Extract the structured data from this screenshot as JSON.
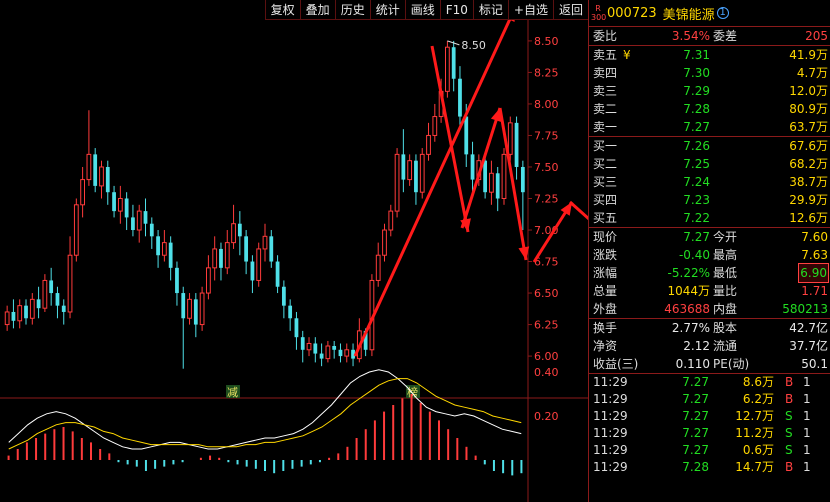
{
  "toolbar": {
    "buttons": [
      "复权",
      "叠加",
      "历史",
      "统计",
      "画线",
      "F10",
      "标记",
      "+自选",
      "返回"
    ]
  },
  "stock": {
    "code": "000723",
    "name": "美锦能源",
    "market_mark_top": "R",
    "market_mark_bottom": "300"
  },
  "committee": {
    "ratio_label": "委比",
    "ratio_value": "3.54%",
    "diff_label": "委差",
    "diff_value": "205"
  },
  "sell": [
    {
      "label": "卖五",
      "price": "7.31",
      "volume": "41.9万"
    },
    {
      "label": "卖四",
      "price": "7.30",
      "volume": "4.7万"
    },
    {
      "label": "卖三",
      "price": "7.29",
      "volume": "12.0万"
    },
    {
      "label": "卖二",
      "price": "7.28",
      "volume": "80.9万"
    },
    {
      "label": "卖一",
      "price": "7.27",
      "volume": "63.7万"
    }
  ],
  "sell_currency_mark": "¥",
  "buy": [
    {
      "label": "买一",
      "price": "7.26",
      "volume": "67.6万"
    },
    {
      "label": "买二",
      "price": "7.25",
      "volume": "68.2万"
    },
    {
      "label": "买三",
      "price": "7.24",
      "volume": "38.7万"
    },
    {
      "label": "买四",
      "price": "7.23",
      "volume": "29.9万"
    },
    {
      "label": "买五",
      "price": "7.22",
      "volume": "12.6万"
    }
  ],
  "quote": [
    {
      "l1": "现价",
      "v1": "7.27",
      "c1": "grn",
      "l2": "今开",
      "v2": "7.60",
      "c2": "yel"
    },
    {
      "l1": "涨跌",
      "v1": "-0.40",
      "c1": "grn",
      "l2": "最高",
      "v2": "7.63",
      "c2": "yel"
    },
    {
      "l1": "涨幅",
      "v1": "-5.22%",
      "c1": "grn",
      "l2": "最低",
      "v2": "6.90",
      "c2": "grn box"
    },
    {
      "l1": "总量",
      "v1": "1044万",
      "c1": "yel",
      "l2": "量比",
      "v2": "1.71",
      "c2": "red"
    },
    {
      "l1": "外盘",
      "v1": "463688",
      "c1": "red",
      "l2": "内盘",
      "v2": "580213",
      "c2": "grn"
    }
  ],
  "fund": [
    {
      "l1": "换手",
      "v1": "2.77%",
      "l2": "股本",
      "v2": "42.7亿"
    },
    {
      "l1": "净资",
      "v1": "2.12",
      "l2": "流通",
      "v2": "37.7亿"
    },
    {
      "l1": "收益(三)",
      "v1": "0.110",
      "l2": "PE(动)",
      "v2": "50.1"
    }
  ],
  "ticks": [
    {
      "time": "11:29",
      "price": "7.27",
      "vol": "8.6万",
      "side": "B",
      "n": "1"
    },
    {
      "time": "11:29",
      "price": "7.27",
      "vol": "6.2万",
      "side": "B",
      "n": "1"
    },
    {
      "time": "11:29",
      "price": "7.27",
      "vol": "12.7万",
      "side": "S",
      "n": "1"
    },
    {
      "time": "11:29",
      "price": "7.27",
      "vol": "11.2万",
      "side": "S",
      "n": "1"
    },
    {
      "time": "11:29",
      "price": "7.27",
      "vol": "0.6万",
      "side": "S",
      "n": "1"
    },
    {
      "time": "11:29",
      "price": "7.28",
      "vol": "14.7万",
      "side": "B",
      "n": "1"
    }
  ],
  "chart_data": {
    "type": "candlestick",
    "yticks": [
      "8.50",
      "8.25",
      "8.00",
      "7.75",
      "7.50",
      "7.25",
      "7.00",
      "6.75",
      "6.50",
      "6.25",
      "6.00"
    ],
    "ylim": [
      5.85,
      8.65
    ],
    "high_label": "8.50",
    "event_labels": [
      "减",
      "榜"
    ],
    "macd_ticks": [
      "0.40",
      "0.20"
    ],
    "candles": [
      [
        6.25,
        6.35,
        6.2,
        6.4
      ],
      [
        6.35,
        6.28,
        6.22,
        6.45
      ],
      [
        6.28,
        6.4,
        6.22,
        6.45
      ],
      [
        6.4,
        6.3,
        6.25,
        6.45
      ],
      [
        6.3,
        6.45,
        6.25,
        6.5
      ],
      [
        6.45,
        6.38,
        6.3,
        6.55
      ],
      [
        6.38,
        6.6,
        6.35,
        6.65
      ],
      [
        6.6,
        6.5,
        6.4,
        6.7
      ],
      [
        6.5,
        6.4,
        6.3,
        6.55
      ],
      [
        6.4,
        6.35,
        6.25,
        6.45
      ],
      [
        6.35,
        6.8,
        6.3,
        6.95
      ],
      [
        6.8,
        7.2,
        6.75,
        7.25
      ],
      [
        7.2,
        7.4,
        7.1,
        7.5
      ],
      [
        7.4,
        7.6,
        7.35,
        7.95
      ],
      [
        7.6,
        7.35,
        7.3,
        7.65
      ],
      [
        7.35,
        7.5,
        7.25,
        7.55
      ],
      [
        7.5,
        7.3,
        7.2,
        7.55
      ],
      [
        7.3,
        7.15,
        7.1,
        7.35
      ],
      [
        7.15,
        7.25,
        7.05,
        7.35
      ],
      [
        7.25,
        7.1,
        7.0,
        7.3
      ],
      [
        7.1,
        7.0,
        6.95,
        7.2
      ],
      [
        7.0,
        7.15,
        6.9,
        7.2
      ],
      [
        7.15,
        7.05,
        6.95,
        7.25
      ],
      [
        7.05,
        6.95,
        6.85,
        7.1
      ],
      [
        6.95,
        6.8,
        6.7,
        7.0
      ],
      [
        6.8,
        6.9,
        6.75,
        7.0
      ],
      [
        6.9,
        6.7,
        6.6,
        6.95
      ],
      [
        6.7,
        6.5,
        6.4,
        6.75
      ],
      [
        6.5,
        6.3,
        5.9,
        6.55
      ],
      [
        6.3,
        6.45,
        6.25,
        6.5
      ],
      [
        6.45,
        6.25,
        6.15,
        6.5
      ],
      [
        6.25,
        6.5,
        6.2,
        6.55
      ],
      [
        6.5,
        6.7,
        6.45,
        6.8
      ],
      [
        6.7,
        6.85,
        6.6,
        6.95
      ],
      [
        6.85,
        6.7,
        6.6,
        6.9
      ],
      [
        6.7,
        6.9,
        6.65,
        7.0
      ],
      [
        6.9,
        7.05,
        6.85,
        7.2
      ],
      [
        7.05,
        6.95,
        6.8,
        7.15
      ],
      [
        6.95,
        6.75,
        6.65,
        7.0
      ],
      [
        6.75,
        6.6,
        6.5,
        6.8
      ],
      [
        6.6,
        6.85,
        6.55,
        6.9
      ],
      [
        6.85,
        6.95,
        6.75,
        7.05
      ],
      [
        6.95,
        6.75,
        6.7,
        7.0
      ],
      [
        6.75,
        6.55,
        6.5,
        6.8
      ],
      [
        6.55,
        6.4,
        6.3,
        6.6
      ],
      [
        6.4,
        6.3,
        6.2,
        6.45
      ],
      [
        6.3,
        6.15,
        6.05,
        6.35
      ],
      [
        6.15,
        6.05,
        5.95,
        6.2
      ],
      [
        6.05,
        6.1,
        6.0,
        6.15
      ],
      [
        6.1,
        6.02,
        5.95,
        6.15
      ],
      [
        6.02,
        5.98,
        5.92,
        6.1
      ],
      [
        5.98,
        6.08,
        5.95,
        6.12
      ],
      [
        6.08,
        6.05,
        5.98,
        6.12
      ],
      [
        6.05,
        6.0,
        5.95,
        6.1
      ],
      [
        6.0,
        6.05,
        5.95,
        6.1
      ],
      [
        6.05,
        5.98,
        5.92,
        6.1
      ],
      [
        5.98,
        6.2,
        5.95,
        6.3
      ],
      [
        6.2,
        6.05,
        6.0,
        6.22
      ],
      [
        6.05,
        6.6,
        6.0,
        6.65
      ],
      [
        6.6,
        6.8,
        6.55,
        6.9
      ],
      [
        6.8,
        7.0,
        6.75,
        7.05
      ],
      [
        7.0,
        7.15,
        6.95,
        7.2
      ],
      [
        7.15,
        7.6,
        7.1,
        7.65
      ],
      [
        7.6,
        7.4,
        7.3,
        7.8
      ],
      [
        7.4,
        7.55,
        7.35,
        7.6
      ],
      [
        7.55,
        7.3,
        7.2,
        7.6
      ],
      [
        7.3,
        7.6,
        7.25,
        7.65
      ],
      [
        7.6,
        7.75,
        7.55,
        7.85
      ],
      [
        7.75,
        7.9,
        7.7,
        8.0
      ],
      [
        7.9,
        8.1,
        7.85,
        8.2
      ],
      [
        8.1,
        8.45,
        8.05,
        8.5
      ],
      [
        8.45,
        8.2,
        8.1,
        8.5
      ],
      [
        8.2,
        7.9,
        7.8,
        8.3
      ],
      [
        7.9,
        7.6,
        7.5,
        8.0
      ],
      [
        7.6,
        7.4,
        7.3,
        7.7
      ],
      [
        7.4,
        7.55,
        7.35,
        7.6
      ],
      [
        7.55,
        7.3,
        7.25,
        7.6
      ],
      [
        7.3,
        7.45,
        7.2,
        7.55
      ],
      [
        7.45,
        7.25,
        7.15,
        7.5
      ],
      [
        7.25,
        7.6,
        7.2,
        7.65
      ],
      [
        7.6,
        7.85,
        7.55,
        7.9
      ],
      [
        7.85,
        7.5,
        7.4,
        7.9
      ],
      [
        7.5,
        7.3,
        7.0,
        7.55
      ]
    ],
    "macd": [
      0.02,
      0.05,
      0.08,
      0.1,
      0.12,
      0.14,
      0.15,
      0.13,
      0.1,
      0.08,
      0.05,
      0.03,
      -0.01,
      -0.02,
      -0.03,
      -0.05,
      -0.04,
      -0.03,
      -0.02,
      -0.01,
      0.0,
      0.01,
      0.02,
      0.01,
      -0.01,
      -0.02,
      -0.03,
      -0.04,
      -0.05,
      -0.06,
      -0.05,
      -0.04,
      -0.03,
      -0.02,
      -0.01,
      0.01,
      0.03,
      0.06,
      0.1,
      0.14,
      0.18,
      0.22,
      0.25,
      0.28,
      0.3,
      0.26,
      0.22,
      0.18,
      0.14,
      0.1,
      0.06,
      0.02,
      -0.02,
      -0.05,
      -0.06,
      -0.07,
      -0.06
    ],
    "dif": [
      0.08,
      0.12,
      0.16,
      0.19,
      0.21,
      0.22,
      0.21,
      0.19,
      0.16,
      0.13,
      0.1,
      0.08,
      0.06,
      0.05,
      0.05,
      0.06,
      0.07,
      0.08,
      0.08,
      0.07,
      0.06,
      0.05,
      0.05,
      0.06,
      0.07,
      0.08,
      0.09,
      0.1,
      0.1,
      0.11,
      0.12,
      0.14,
      0.17,
      0.21,
      0.25,
      0.3,
      0.35,
      0.38,
      0.4,
      0.41,
      0.4,
      0.37,
      0.33,
      0.28,
      0.24,
      0.22,
      0.21,
      0.2,
      0.21,
      0.2,
      0.18,
      0.16,
      0.14,
      0.13,
      0.12
    ],
    "dea": [
      0.05,
      0.07,
      0.09,
      0.12,
      0.14,
      0.16,
      0.17,
      0.17,
      0.16,
      0.15,
      0.13,
      0.12,
      0.1,
      0.09,
      0.08,
      0.07,
      0.07,
      0.07,
      0.07,
      0.07,
      0.07,
      0.06,
      0.06,
      0.06,
      0.06,
      0.07,
      0.07,
      0.08,
      0.08,
      0.09,
      0.1,
      0.11,
      0.13,
      0.15,
      0.18,
      0.21,
      0.25,
      0.28,
      0.31,
      0.34,
      0.36,
      0.37,
      0.37,
      0.35,
      0.32,
      0.29,
      0.27,
      0.25,
      0.24,
      0.23,
      0.22,
      0.2,
      0.19,
      0.18,
      0.17
    ]
  }
}
